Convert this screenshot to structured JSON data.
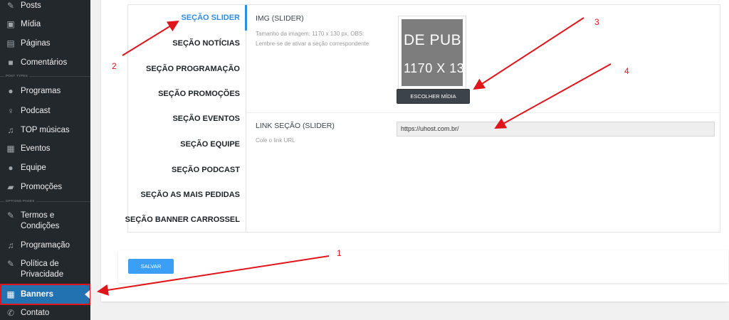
{
  "sidebar": {
    "items": [
      {
        "label": "Posts",
        "icon": "pin-icon"
      },
      {
        "label": "Mídia",
        "icon": "media-icon"
      },
      {
        "label": "Páginas",
        "icon": "pages-icon"
      },
      {
        "label": "Comentários",
        "icon": "comments-icon"
      },
      {
        "label": "Programas",
        "icon": "user-icon"
      },
      {
        "label": "Podcast",
        "icon": "microphone-icon"
      },
      {
        "label": "TOP músicas",
        "icon": "music-icon"
      },
      {
        "label": "Eventos",
        "icon": "calendar-icon"
      },
      {
        "label": "Equipe",
        "icon": "user-icon"
      },
      {
        "label": "Promoções",
        "icon": "promo-icon"
      },
      {
        "label": "Termos e Condições",
        "icon": "pencil-icon"
      },
      {
        "label": "Programação",
        "icon": "music-icon"
      },
      {
        "label": "Política de Privacidade",
        "icon": "pencil-icon"
      },
      {
        "label": "Banners",
        "icon": "banner-icon"
      },
      {
        "label": "Contato",
        "icon": "phone-icon"
      }
    ],
    "separators": [
      "POST TYPES",
      "OPTIONS PAGES"
    ],
    "active": "Banners"
  },
  "tabs": [
    "SEÇÃO SLIDER",
    "SEÇÃO NOTÍCIAS",
    "SEÇÃO PROGRAMAÇÃO",
    "SEÇÃO PROMOÇÕES",
    "SEÇÃO EVENTOS",
    "SEÇÃO EQUIPE",
    "SEÇÃO PODCAST",
    "SEÇÃO AS MAIS PEDIDAS",
    "SEÇÃO BANNER CARROSSEL"
  ],
  "active_tab": "SEÇÃO SLIDER",
  "fields": {
    "img": {
      "label": "IMG (SLIDER)",
      "desc1": "Tamanho da imagem: 1170 x 130 px. OBS:",
      "desc2": "Lembre-se de ativar a seção correspondente",
      "thumb_text1": "DE PUB",
      "thumb_text2": "1170 X 13",
      "button": "ESCOLHER MÍDIA"
    },
    "link": {
      "label": "LINK SEÇÃO (SLIDER)",
      "desc": "Cole o link URL",
      "value": "https://uhost.com.br/"
    }
  },
  "save_button": "SALVAR",
  "annotations": [
    "1",
    "2",
    "3",
    "4"
  ],
  "colors": {
    "sidebar_bg": "#23282d",
    "active_item": "#2271b1",
    "active_tab": "#2f8ee0",
    "save_button": "#3a9ff5",
    "annotation_red": "#e0151b"
  }
}
